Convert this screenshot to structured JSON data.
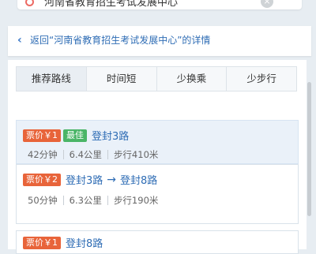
{
  "destination": {
    "text": "河南省教育招生考试发展中心",
    "clear_icon": "close-icon"
  },
  "back": {
    "icon": "chevron-left-icon",
    "text": "返回“河南省教育招生考试发展中心”的详情"
  },
  "tabs": [
    {
      "label": "推荐路线",
      "active": true
    },
    {
      "label": "时间短"
    },
    {
      "label": "少换乘"
    },
    {
      "label": "少步行"
    }
  ],
  "routes": [
    {
      "price": "票价￥1",
      "best": "最佳",
      "lines": [
        "登封3路"
      ],
      "duration": "42分钟",
      "distance": "6.4公里",
      "walk": "步行410米"
    },
    {
      "price": "票价￥2",
      "lines": [
        "登封3路",
        "登封8路"
      ],
      "arrow": "→",
      "duration": "50分钟",
      "distance": "6.3公里",
      "walk": "步行190米"
    },
    {
      "price": "票价￥1",
      "lines": [
        "登封8路"
      ]
    }
  ],
  "colors": {
    "price_badge": "#e8643a",
    "best_badge": "#4ab567",
    "link": "#2f6db5"
  }
}
